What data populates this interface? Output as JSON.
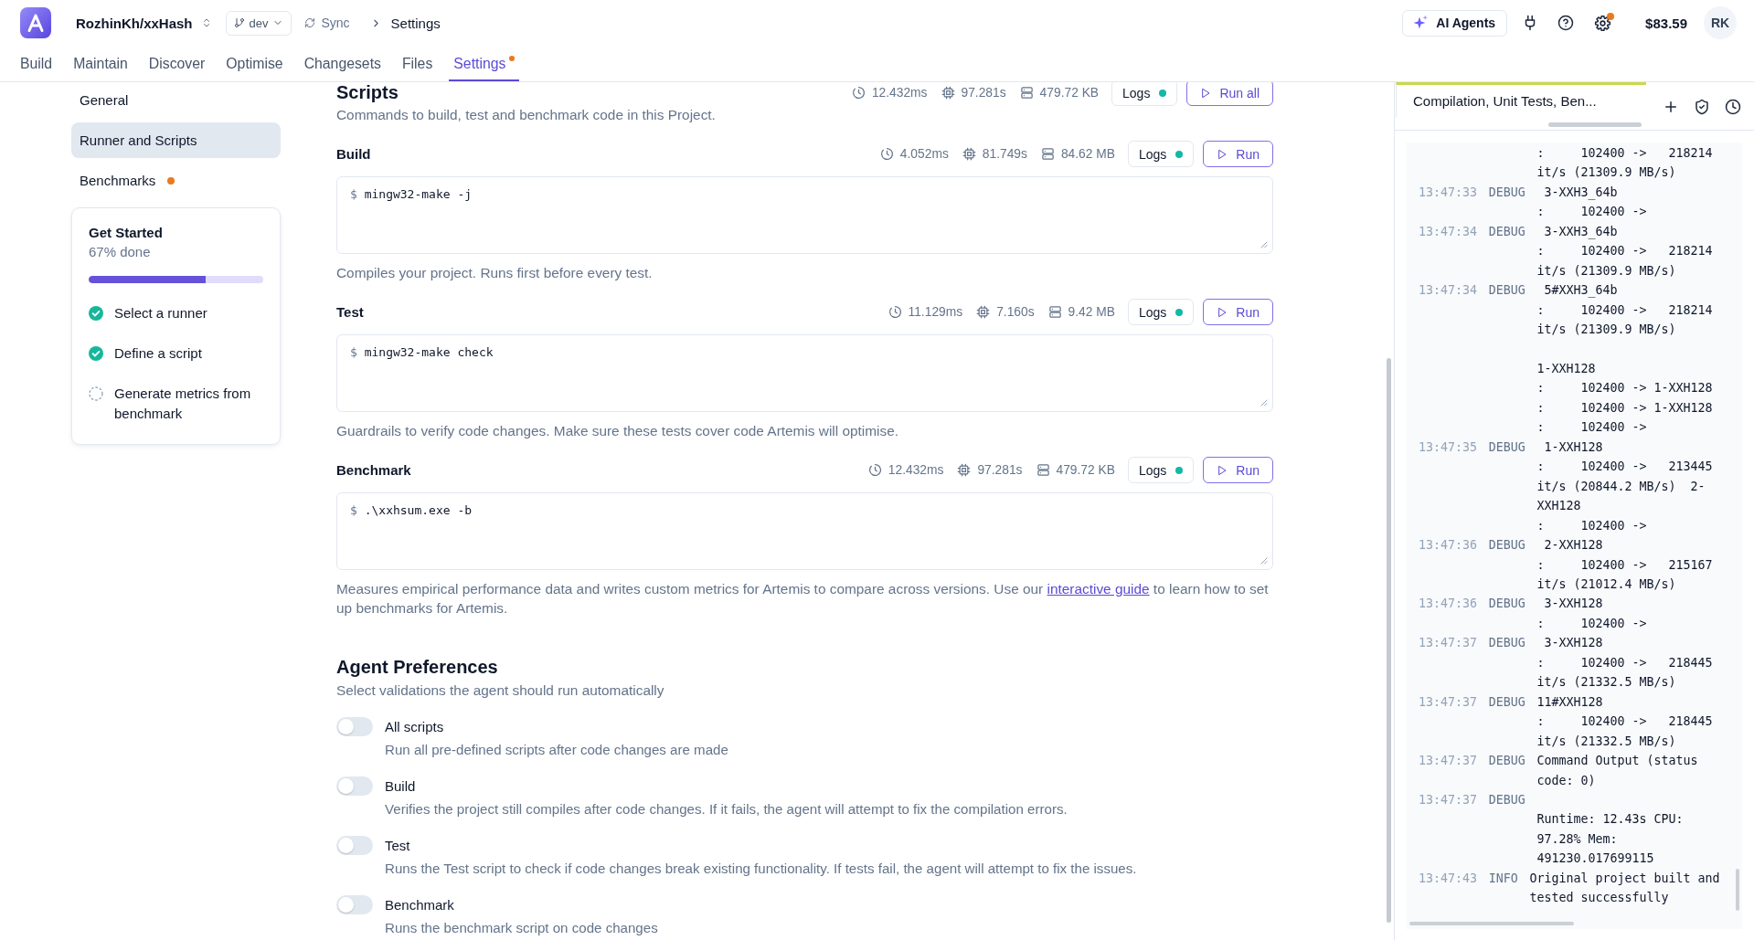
{
  "top_bar": {
    "project": "RozhinKh/xxHash",
    "branch": "dev",
    "sync": "Sync",
    "breadcrumb": "Settings",
    "ai_agents": "AI Agents",
    "settings_badge": true,
    "balance": "$83.59",
    "avatar": "RK"
  },
  "tabs": [
    {
      "label": "Build",
      "selected": false,
      "dot": false
    },
    {
      "label": "Maintain",
      "selected": false,
      "dot": false
    },
    {
      "label": "Discover",
      "selected": false,
      "dot": false
    },
    {
      "label": "Optimise",
      "selected": false,
      "dot": false
    },
    {
      "label": "Changesets",
      "selected": false,
      "dot": false
    },
    {
      "label": "Files",
      "selected": false,
      "dot": false
    },
    {
      "label": "Settings",
      "selected": true,
      "dot": true
    }
  ],
  "sidebar": {
    "items": [
      {
        "label": "General",
        "selected": false,
        "dot": false
      },
      {
        "label": "Runner and Scripts",
        "selected": true,
        "dot": false
      },
      {
        "label": "Benchmarks",
        "selected": false,
        "dot": true
      }
    ],
    "get_started": {
      "title": "Get Started",
      "progress": "67% done",
      "level": 0.67,
      "steps": [
        {
          "label": "Select a runner",
          "done": true
        },
        {
          "label": "Define a script",
          "done": true
        },
        {
          "label": "Generate metrics from benchmark",
          "done": false
        }
      ]
    }
  },
  "scripts": {
    "title": "Scripts",
    "description": "Commands to build, test and benchmark code in this Project.",
    "stats": {
      "duration": "12.432ms",
      "cpu": "97.281s",
      "memory": "479.72 KB"
    },
    "logs": {
      "label": "Logs",
      "ready": true
    },
    "run_all": "Run all",
    "items": [
      {
        "name": "Build",
        "stats": {
          "duration": "4.052ms",
          "cpu": "81.749s",
          "memory": "84.62 MB"
        },
        "logs": {
          "label": "Logs",
          "ready": true
        },
        "run": "Run",
        "prompt": "$",
        "command": "mingw32-make -j",
        "help": "Compiles your project. Runs first before every test."
      },
      {
        "name": "Test",
        "stats": {
          "duration": "11.129ms",
          "cpu": "7.160s",
          "memory": "9.42 MB"
        },
        "logs": {
          "label": "Logs",
          "ready": true
        },
        "run": "Run",
        "prompt": "$",
        "command": "mingw32-make check",
        "help": "Guardrails to verify code changes. Make sure these tests cover code Artemis will optimise."
      },
      {
        "name": "Benchmark",
        "stats": {
          "duration": "12.432ms",
          "cpu": "97.281s",
          "memory": "479.72 KB"
        },
        "logs": {
          "label": "Logs",
          "ready": true
        },
        "run": "Run",
        "prompt": "$",
        "command": ".\\xxhsum.exe -b",
        "help": "Measures empirical performance data and writes custom metrics for Artemis to compare across versions. Use our",
        "help_link": "interactive guide",
        "help_after": "to learn how to set up benchmarks for Artemis."
      }
    ]
  },
  "agent_preferences": {
    "title": "Agent Preferences",
    "subtitle": "Select validations the agent should run automatically",
    "options": [
      {
        "label": "All scripts",
        "description": "Run all pre-defined scripts after code changes are made",
        "on": false
      },
      {
        "label": "Build",
        "description": "Verifies the project still compiles after code changes. If it fails, the agent will attempt to fix the compilation errors.",
        "on": false
      },
      {
        "label": "Test",
        "description": "Runs the Test script to check if code changes break existing functionality. If tests fail, the agent will attempt to fix the issues.",
        "on": false
      },
      {
        "label": "Benchmark",
        "description": "Runs the benchmark script on code changes",
        "on": false
      }
    ]
  },
  "output_panel": {
    "tab": "Compilation, Unit Tests, Ben...",
    "log": [
      {
        "message": ":     102400 ->   218214\nit/s (21309.9 MB/s)"
      },
      {
        "time": "13:47:33",
        "severity": "DEBUG",
        "message": " 3-XXH3_64b\n:     102400 ->"
      },
      {
        "time": "13:47:34",
        "severity": "DEBUG",
        "message": " 3-XXH3_64b\n:     102400 ->   218214\nit/s (21309.9 MB/s)"
      },
      {
        "time": "13:47:34",
        "severity": "DEBUG",
        "message": " 5#XXH3_64b\n:     102400 ->   218214\nit/s (21309.9 MB/s)\n\n1-XXH128\n:     102400 -> 1-XXH128\n:     102400 -> 1-XXH128\n:     102400 ->"
      },
      {
        "time": "13:47:35",
        "severity": "DEBUG",
        "message": " 1-XXH128\n:     102400 ->   213445\nit/s (20844.2 MB/s)  2-\nXXH128\n:     102400 ->"
      },
      {
        "time": "13:47:36",
        "severity": "DEBUG",
        "message": " 2-XXH128\n:     102400 ->   215167\nit/s (21012.4 MB/s)"
      },
      {
        "time": "13:47:36",
        "severity": "DEBUG",
        "message": " 3-XXH128\n:     102400 ->"
      },
      {
        "time": "13:47:37",
        "severity": "DEBUG",
        "message": " 3-XXH128\n:     102400 ->   218445\nit/s (21332.5 MB/s)"
      },
      {
        "time": "13:47:37",
        "severity": "DEBUG",
        "message": "11#XXH128\n:     102400 ->   218445\nit/s (21332.5 MB/s)"
      },
      {
        "time": "13:47:37",
        "severity": "DEBUG",
        "message": "Command Output (status\ncode: 0)"
      },
      {
        "time": "13:47:37",
        "severity": "DEBUG",
        "message": "\nRuntime: 12.43s CPU:\n97.28% Mem:\n491230.017699115"
      },
      {
        "time": "13:47:43",
        "severity": "INFO",
        "message": "Original project built and\ntested successfully"
      }
    ]
  }
}
